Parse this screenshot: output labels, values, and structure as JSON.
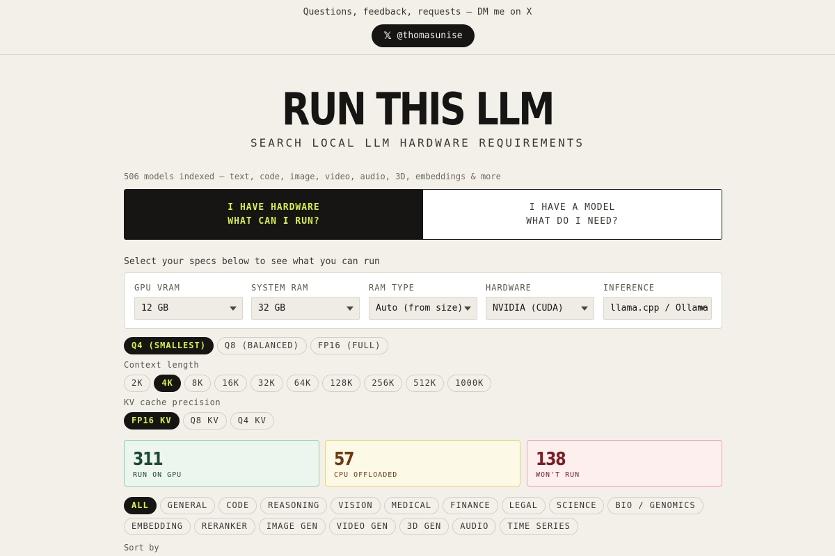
{
  "topbar": {
    "message": "Questions, feedback, requests — DM me on X",
    "x_button": {
      "icon": "x-logo-icon",
      "icon_glyph": "𝕏",
      "label": "@thomasunise"
    }
  },
  "hero": {
    "title": "RUN THIS LLM",
    "subtitle": "SEARCH LOCAL LLM HARDWARE REQUIREMENTS"
  },
  "indexed_text": "506 models indexed — text, code, image, video, audio, 3D, embeddings & more",
  "modes": {
    "hardware": {
      "line1": "I HAVE HARDWARE",
      "line2": "WHAT CAN I RUN?"
    },
    "model": {
      "line1": "I HAVE A MODEL",
      "line2": "WHAT DO I NEED?"
    }
  },
  "specs_hint": "Select your specs below to see what you can run",
  "specs": [
    {
      "label": "GPU VRAM",
      "value": "12 GB"
    },
    {
      "label": "SYSTEM RAM",
      "value": "32 GB"
    },
    {
      "label": "RAM TYPE",
      "value": "Auto (from size)"
    },
    {
      "label": "HARDWARE",
      "value": "NVIDIA (CUDA)"
    },
    {
      "label": "INFERENCE",
      "value": "llama.cpp / Ollama"
    }
  ],
  "quant": [
    "Q4 (SMALLEST)",
    "Q8 (BALANCED)",
    "FP16 (FULL)"
  ],
  "context": {
    "label": "Context length",
    "options": [
      "2K",
      "4K",
      "8K",
      "16K",
      "32K",
      "64K",
      "128K",
      "256K",
      "512K",
      "1000K"
    ]
  },
  "kv": {
    "label": "KV cache precision",
    "options": [
      "FP16 KV",
      "Q8 KV",
      "Q4 KV"
    ]
  },
  "stats": {
    "gpu": {
      "value": "311",
      "caption": "RUN ON GPU"
    },
    "offload": {
      "value": "57",
      "caption": "CPU OFFLOADED"
    },
    "wont": {
      "value": "138",
      "caption": "WON'T RUN"
    }
  },
  "categories_row1": [
    "ALL",
    "GENERAL",
    "CODE",
    "REASONING",
    "VISION",
    "MEDICAL",
    "FINANCE",
    "LEGAL",
    "SCIENCE",
    "BIO / GENOMICS"
  ],
  "categories_row2": [
    "EMBEDDING",
    "RERANKER",
    "IMAGE GEN",
    "VIDEO GEN",
    "3D GEN",
    "AUDIO",
    "TIME SERIES"
  ],
  "sort_label": "Sort by"
}
